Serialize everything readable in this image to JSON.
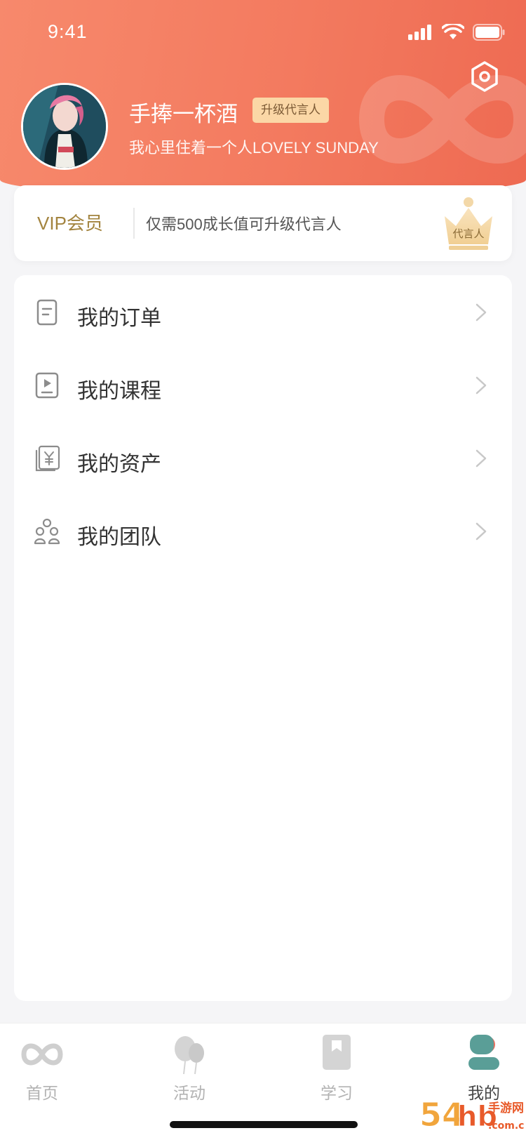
{
  "status": {
    "time": "9:41"
  },
  "profile": {
    "name": "手捧一杯酒",
    "badge": "升级代言人",
    "signature": "我心里住着一个人LOVELY SUNDAY"
  },
  "vip": {
    "label": "VIP会员",
    "description": "仅需500成长值可升级代言人",
    "crown_label": "代言人"
  },
  "menu": [
    {
      "label": "我的订单",
      "icon": "order-icon"
    },
    {
      "label": "我的课程",
      "icon": "course-icon"
    },
    {
      "label": "我的资产",
      "icon": "asset-icon"
    },
    {
      "label": "我的团队",
      "icon": "team-icon"
    }
  ],
  "tabs": [
    {
      "label": "首页",
      "icon": "home-infinity-icon",
      "active": false
    },
    {
      "label": "活动",
      "icon": "balloon-icon",
      "active": false
    },
    {
      "label": "学习",
      "icon": "book-icon",
      "active": false
    },
    {
      "label": "我的",
      "icon": "profile-icon",
      "active": true
    }
  ],
  "colors": {
    "header_start": "#f7896c",
    "header_end": "#ee6a52",
    "badge_bg": "#fbd7a6",
    "vip_gold": "#a3843f",
    "active_tab": "#5a9e97"
  },
  "watermark": {
    "digits": "54",
    "glyphs": "hb",
    "site": "手游网",
    "domain": ".com.cn"
  }
}
